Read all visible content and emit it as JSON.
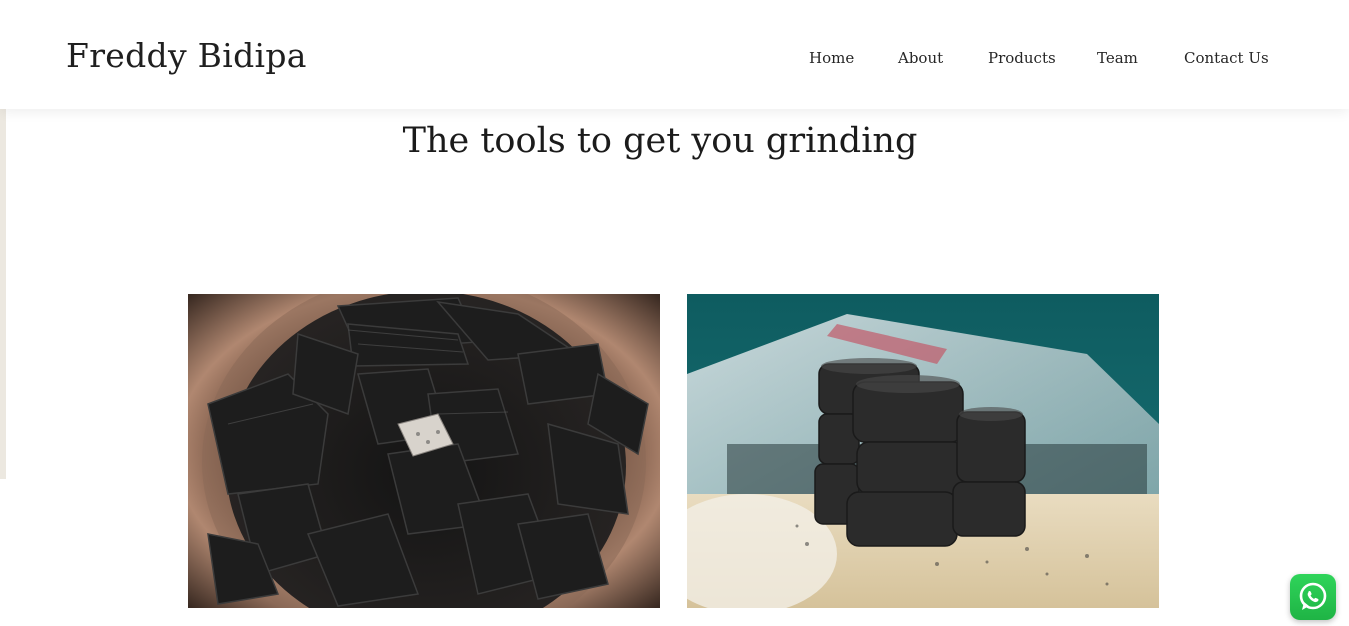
{
  "header": {
    "brand": "Freddy Bidipa",
    "nav": [
      {
        "label": "Home"
      },
      {
        "label": "About"
      },
      {
        "label": "Products"
      },
      {
        "label": "Team"
      },
      {
        "label": "Contact Us"
      }
    ]
  },
  "main": {
    "headline": "The tools to get you grinding",
    "gallery": [
      {
        "subject": "charcoal-lumps-in-clay-bowl"
      },
      {
        "subject": "charcoal-briquette-stacks"
      }
    ]
  },
  "floating": {
    "whatsapp_icon": "whatsapp-icon",
    "accent": "#25d366"
  },
  "colors": {
    "text": "#1e1e1e",
    "background": "#ffffff"
  }
}
